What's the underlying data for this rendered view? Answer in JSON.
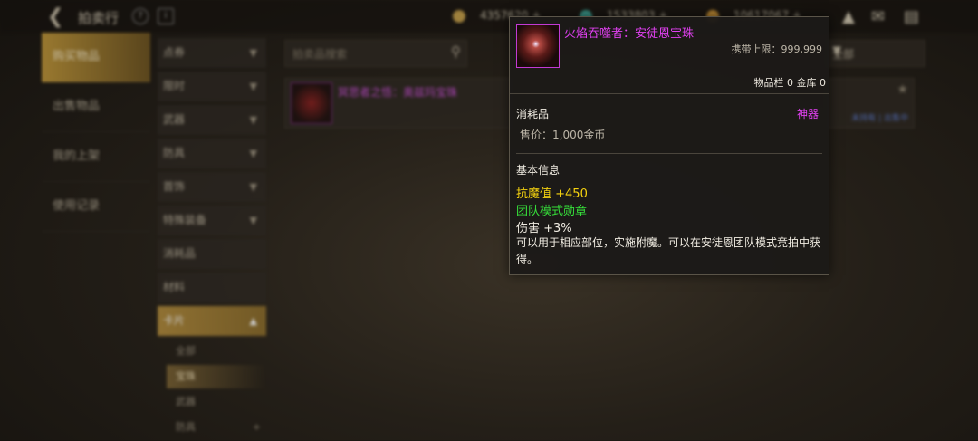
{
  "topbar": {
    "title": "拍卖行",
    "currencies": [
      {
        "value": "4357620 +",
        "color": "#c9a24a"
      },
      {
        "value": "1533803 +",
        "color": "#3fb4a6"
      },
      {
        "value": "10617067 +",
        "color": "#e2a33a"
      }
    ]
  },
  "leftnav": {
    "items": [
      {
        "label": "购买物品",
        "active": true
      },
      {
        "label": "出售物品",
        "active": false
      },
      {
        "label": "我的上架",
        "active": false
      },
      {
        "label": "使用记录",
        "active": false
      }
    ]
  },
  "categories": [
    {
      "label": "点券",
      "expandable": true
    },
    {
      "label": "限时",
      "expandable": true
    },
    {
      "label": "武器",
      "expandable": true
    },
    {
      "label": "防具",
      "expandable": true
    },
    {
      "label": "首饰",
      "expandable": true
    },
    {
      "label": "特殊装备",
      "expandable": true
    },
    {
      "label": "消耗品",
      "expandable": false
    },
    {
      "label": "材料",
      "expandable": false
    },
    {
      "label": "卡片",
      "expandable": true,
      "open": true
    }
  ],
  "subcategories": [
    {
      "label": "全部",
      "active": false
    },
    {
      "label": "宝珠",
      "active": true
    },
    {
      "label": "武器",
      "active": false
    },
    {
      "label": "防具",
      "active": false
    }
  ],
  "search": {
    "placeholder": "拍卖品搜索"
  },
  "results": [
    {
      "name": "冥思者之悟：奥兹玛宝珠"
    }
  ],
  "filter": {
    "label": "全部"
  },
  "right_row": {
    "status": "未持有 | 出售中"
  },
  "tooltip": {
    "name": "火焰吞噬者：安徒恩宝珠",
    "limit": "携带上限：999,999",
    "inventory": "物品栏 0 金库 0",
    "type": "消耗品",
    "grade": "神器",
    "price": "售价：1,000金币",
    "section": "基本信息",
    "stat1": "抗魔值 +450",
    "stat2": "团队模式勋章",
    "stat3": "伤害 +3%",
    "desc": "可以用于相应部位，实施附魔。可以在安徒恩团队模式竞拍中获得。"
  }
}
